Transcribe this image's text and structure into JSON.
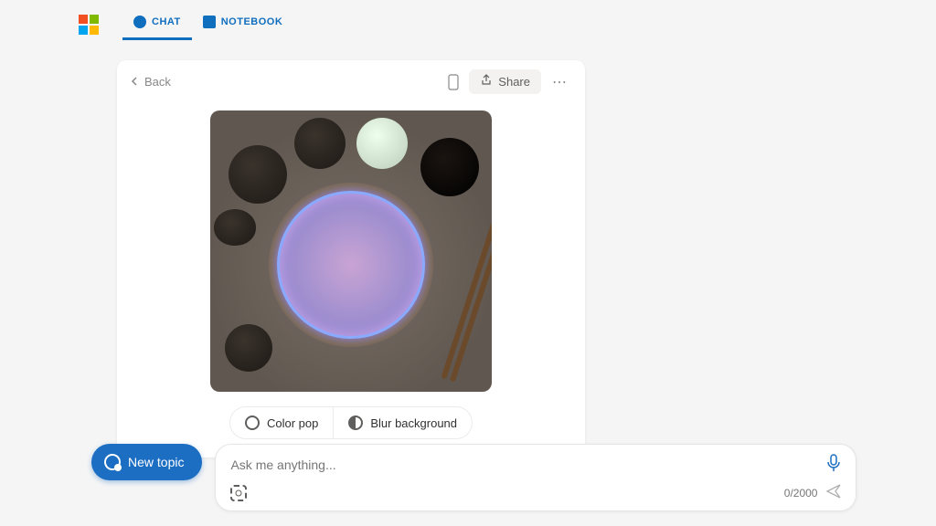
{
  "tabs": {
    "chat": "CHAT",
    "notebook": "NOTEBOOK"
  },
  "header": {
    "back": "Back",
    "share": "Share"
  },
  "actions": {
    "color_pop": "Color pop",
    "blur_bg": "Blur background"
  },
  "compose": {
    "new_topic": "New topic",
    "placeholder": "Ask me anything...",
    "char_count": "0/2000"
  },
  "colors": {
    "ms_red": "#f25022",
    "ms_green": "#7fba00",
    "ms_blue": "#00a4ef",
    "ms_yellow": "#ffb900",
    "primary": "#1b6ec2",
    "tab_accent": "#106ebe"
  },
  "icons": {
    "chat_tab": "chat-bubble",
    "notebook_tab": "notebook",
    "mobile": "phone",
    "share": "share",
    "more": "more",
    "color_pop": "color-circle",
    "blur": "half-circle",
    "new_topic": "chat-plus",
    "mic": "microphone",
    "lens": "visual-search",
    "send": "send-arrow",
    "chevron_left": "chevron-left"
  }
}
